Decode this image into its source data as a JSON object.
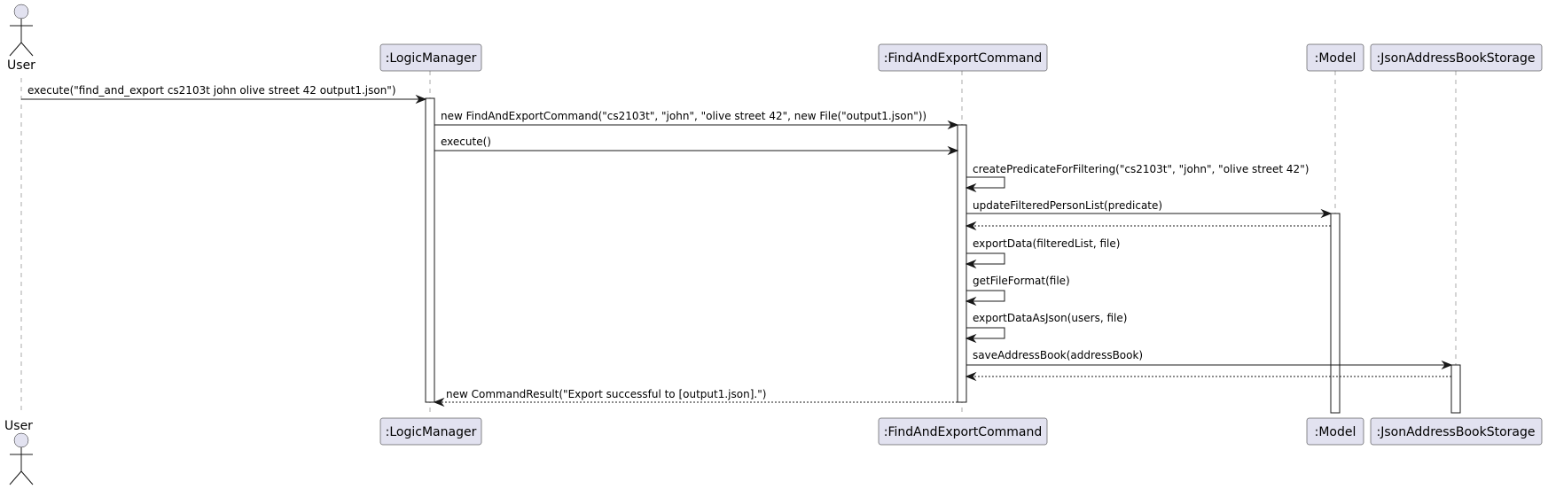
{
  "participants": {
    "user": {
      "label": "User"
    },
    "logic_manager": {
      "label": ":LogicManager"
    },
    "find_export_command": {
      "label": ":FindAndExportCommand"
    },
    "model": {
      "label": ":Model"
    },
    "storage": {
      "label": ":JsonAddressBookStorage"
    }
  },
  "messages": {
    "m1": "execute(\"find_and_export cs2103t john olive street 42 output1.json\")",
    "m2": "new FindAndExportCommand(\"cs2103t\", \"john\", \"olive street 42\", new File(\"output1.json\"))",
    "m3": "execute()",
    "m4": "createPredicateForFiltering(\"cs2103t\", \"john\", \"olive street 42\")",
    "m5": "updateFilteredPersonList(predicate)",
    "m7": "exportData(filteredList, file)",
    "m8": "getFileFormat(file)",
    "m9": "exportDataAsJson(users, file)",
    "m10": "saveAddressBook(addressBook)",
    "m12": "new CommandResult(\"Export successful to [output1.json].\")"
  },
  "colors": {
    "participant_fill": "#e2e2f0",
    "border": "#181818",
    "lifeline": "#a9a9a9"
  }
}
